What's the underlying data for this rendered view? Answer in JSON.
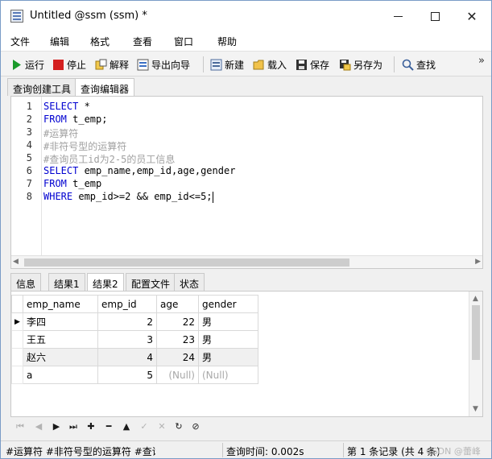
{
  "window": {
    "title": "Untitled @ssm (ssm) *",
    "min_glyph": "",
    "max_glyph": "",
    "close_glyph": "✕"
  },
  "menu": [
    "文件",
    "编辑",
    "格式",
    "查看",
    "窗口",
    "帮助"
  ],
  "toolbar": {
    "run": "运行",
    "stop": "停止",
    "explain": "解释",
    "export_wizard": "导出向导",
    "new": "新建",
    "load": "载入",
    "save": "保存",
    "save_as": "另存为",
    "find": "查找",
    "more": "»",
    "icons": {
      "run": "play-icon",
      "stop": "stop-icon",
      "explain": "explain-icon",
      "export_wizard": "export-icon",
      "new": "new-query-icon",
      "load": "folder-icon",
      "save": "floppy-icon",
      "save_as": "save-as-icon",
      "find": "search-icon"
    },
    "colors": {
      "run": "#1a9a2b",
      "stop": "#d42020"
    }
  },
  "query_tabs": [
    "查询创建工具",
    "查询编辑器"
  ],
  "editor": {
    "line_numbers": [
      "1",
      "2",
      "3",
      "4",
      "5",
      "6",
      "7",
      "8"
    ],
    "lines": [
      {
        "kw": "SELECT",
        "rest": " *"
      },
      {
        "kw": "FROM",
        "rest": " t_emp;"
      },
      {
        "comment": "#运算符"
      },
      {
        "comment": "#非符号型的运算符"
      },
      {
        "comment": "#查询员工id为2-5的员工信息"
      },
      {
        "kw": "SELECT",
        "rest": " emp_name,emp_id,age,gender"
      },
      {
        "kw": "FROM",
        "rest": " t_emp"
      },
      {
        "kw": "WHERE",
        "rest": " emp_id>=2 && emp_id<=5;"
      }
    ],
    "colors": {
      "keyword": "#0000d0",
      "comment": "#a0a0a0"
    }
  },
  "result_tabs": [
    "信息",
    "结果1",
    "结果2",
    "配置文件",
    "状态"
  ],
  "grid": {
    "columns": [
      "emp_name",
      "emp_id",
      "age",
      "gender"
    ],
    "rows": [
      {
        "emp_name": "李四",
        "emp_id": "2",
        "age": "22",
        "gender": "男"
      },
      {
        "emp_name": "王五",
        "emp_id": "3",
        "age": "23",
        "gender": "男"
      },
      {
        "emp_name": "赵六",
        "emp_id": "4",
        "age": "24",
        "gender": "男"
      },
      {
        "emp_name": "a",
        "emp_id": "5",
        "age": "(Null)",
        "gender": "(Null)"
      }
    ],
    "current_row_marker": "▶"
  },
  "navigation": {
    "buttons": [
      {
        "name": "first-record-icon",
        "glyph": "⏮",
        "enabled": false
      },
      {
        "name": "prev-record-icon",
        "glyph": "◀",
        "enabled": false
      },
      {
        "name": "next-record-icon",
        "glyph": "▶",
        "enabled": true
      },
      {
        "name": "last-record-icon",
        "glyph": "⏭",
        "enabled": true
      },
      {
        "name": "add-record-icon",
        "glyph": "✚",
        "enabled": true
      },
      {
        "name": "delete-record-icon",
        "glyph": "━",
        "enabled": true
      },
      {
        "name": "up-icon",
        "glyph": "▲",
        "enabled": true
      },
      {
        "name": "apply-icon",
        "glyph": "✓",
        "enabled": false
      },
      {
        "name": "cancel-icon",
        "glyph": "✕",
        "enabled": false
      },
      {
        "name": "refresh-icon",
        "glyph": "↻",
        "enabled": true
      },
      {
        "name": "stop-refresh-icon",
        "glyph": "⊘",
        "enabled": true
      }
    ]
  },
  "status": {
    "sql_preview": "#运算符 #非符号型的运算符 #查询",
    "query_time": "查询时间: 0.002s",
    "record_info": "第 1 条记录 (共 4 条)"
  },
  "watermark": "CSDN @蕾峰"
}
